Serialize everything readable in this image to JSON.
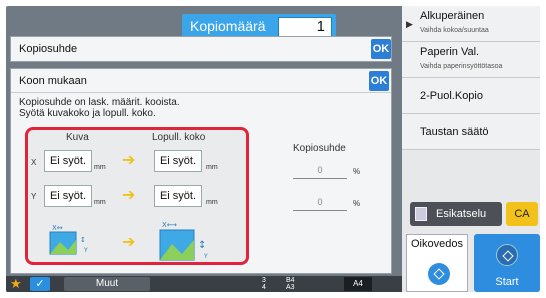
{
  "copies": {
    "label": "Kopiomäärä",
    "value": "1"
  },
  "right_panel": {
    "items": [
      {
        "title": "Alkuperäinen",
        "sub": "Vaihda kokoa/suuntaa"
      },
      {
        "title": "Paperin Val.",
        "sub": "Vaihda paperinsyöttötasoa"
      },
      {
        "title": "2-Puol.Kopio"
      },
      {
        "title": "Taustan säätö"
      }
    ],
    "preview_label": "Esikatselu",
    "ca_label": "CA",
    "bw_label": "Oikovedos",
    "start_label": "Start"
  },
  "dialog1": {
    "title": "Kopiosuhde",
    "ok": "OK"
  },
  "dialog2": {
    "title": "Koon mukaan",
    "ok": "OK",
    "desc_line1": "Kopiosuhde on lask. määrit. kooista.",
    "desc_line2": "Syötä kuvakoko ja lopull. koko.",
    "col_image": "Kuva",
    "col_final": "Lopull. koko",
    "x_label": "X",
    "y_label": "Y",
    "x_image": "Ei syöt.",
    "x_final": "Ei syöt.",
    "y_image": "Ei syöt.",
    "y_final": "Ei syöt.",
    "unit": "mm",
    "ratio_title": "Kopiosuhde",
    "ratio_x": "0",
    "ratio_y": "0",
    "pct": "%"
  },
  "bottom": {
    "muut": "Muut",
    "tray_3": "3",
    "tray_3_size": "B4",
    "tray_4": "4",
    "tray_4_size": "A3",
    "paper": "A4"
  },
  "colors": {
    "accent": "#3aa5e8",
    "ok": "#2c7ed6",
    "highlight": "#e0243a",
    "arrow": "#f2c21a"
  }
}
